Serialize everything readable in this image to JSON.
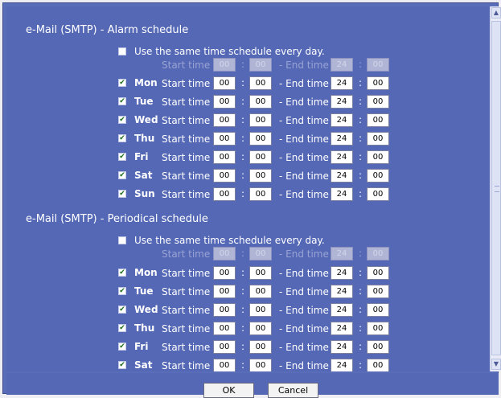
{
  "alarm": {
    "title": "e-Mail (SMTP) - Alarm schedule",
    "same_schedule": {
      "label": "Use the same time schedule every day.",
      "checked": false
    },
    "common": {
      "start_label": "Start time",
      "start_hour": "00",
      "start_min": "00",
      "end_label": "- End time",
      "end_hour": "24",
      "end_min": "00"
    },
    "days": [
      {
        "day": "Mon",
        "checked": true,
        "start_label": "Start time",
        "start_hour": "00",
        "start_min": "00",
        "end_label": "- End time",
        "end_hour": "24",
        "end_min": "00"
      },
      {
        "day": "Tue",
        "checked": true,
        "start_label": "Start time",
        "start_hour": "00",
        "start_min": "00",
        "end_label": "- End time",
        "end_hour": "24",
        "end_min": "00"
      },
      {
        "day": "Wed",
        "checked": true,
        "start_label": "Start time",
        "start_hour": "00",
        "start_min": "00",
        "end_label": "- End time",
        "end_hour": "24",
        "end_min": "00"
      },
      {
        "day": "Thu",
        "checked": true,
        "start_label": "Start time",
        "start_hour": "00",
        "start_min": "00",
        "end_label": "- End time",
        "end_hour": "24",
        "end_min": "00"
      },
      {
        "day": "Fri",
        "checked": true,
        "start_label": "Start time",
        "start_hour": "00",
        "start_min": "00",
        "end_label": "- End time",
        "end_hour": "24",
        "end_min": "00"
      },
      {
        "day": "Sat",
        "checked": true,
        "start_label": "Start time",
        "start_hour": "00",
        "start_min": "00",
        "end_label": "- End time",
        "end_hour": "24",
        "end_min": "00"
      },
      {
        "day": "Sun",
        "checked": true,
        "start_label": "Start time",
        "start_hour": "00",
        "start_min": "00",
        "end_label": "- End time",
        "end_hour": "24",
        "end_min": "00"
      }
    ]
  },
  "periodical": {
    "title": "e-Mail (SMTP) - Periodical schedule",
    "same_schedule": {
      "label": "Use the same time schedule every day.",
      "checked": false
    },
    "common": {
      "start_label": "Start time",
      "start_hour": "00",
      "start_min": "00",
      "end_label": "- End time",
      "end_hour": "24",
      "end_min": "00"
    },
    "days": [
      {
        "day": "Mon",
        "checked": true,
        "start_label": "Start time",
        "start_hour": "00",
        "start_min": "00",
        "end_label": "- End time",
        "end_hour": "24",
        "end_min": "00"
      },
      {
        "day": "Tue",
        "checked": true,
        "start_label": "Start time",
        "start_hour": "00",
        "start_min": "00",
        "end_label": "- End time",
        "end_hour": "24",
        "end_min": "00"
      },
      {
        "day": "Wed",
        "checked": true,
        "start_label": "Start time",
        "start_hour": "00",
        "start_min": "00",
        "end_label": "- End time",
        "end_hour": "24",
        "end_min": "00"
      },
      {
        "day": "Thu",
        "checked": true,
        "start_label": "Start time",
        "start_hour": "00",
        "start_min": "00",
        "end_label": "- End time",
        "end_hour": "24",
        "end_min": "00"
      },
      {
        "day": "Fri",
        "checked": true,
        "start_label": "Start time",
        "start_hour": "00",
        "start_min": "00",
        "end_label": "- End time",
        "end_hour": "24",
        "end_min": "00"
      },
      {
        "day": "Sat",
        "checked": true,
        "start_label": "Start time",
        "start_hour": "00",
        "start_min": "00",
        "end_label": "- End time",
        "end_hour": "24",
        "end_min": "00"
      }
    ]
  },
  "checkbox_mark": "✔",
  "icons": {
    "scroll_up": "scroll-up-arrow-icon",
    "scroll_down": "scroll-down-arrow-icon"
  },
  "buttons": {
    "ok": "OK",
    "cancel": "Cancel"
  },
  "colors": {
    "panel_bg": "#5568b6",
    "text": "#ffffff",
    "disabled_text": "#99a3d3",
    "check": "#1c6e1c"
  }
}
